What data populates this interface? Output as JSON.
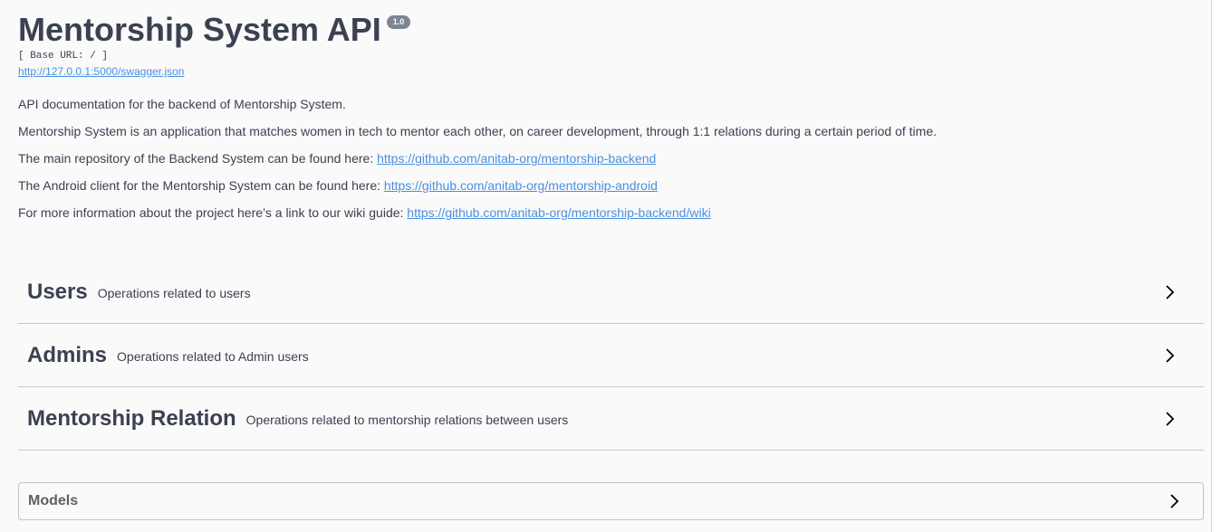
{
  "header": {
    "title": "Mentorship System API",
    "version": "1.0",
    "base_url": "[ Base URL: / ]",
    "spec_link": "http://127.0.0.1:5000/swagger.json"
  },
  "description": {
    "line1": "API documentation for the backend of Mentorship System.",
    "line2": "Mentorship System is an application that matches women in tech to mentor each other, on career development, through 1:1 relations during a certain period of time.",
    "line3_text": "The main repository of the Backend System can be found here: ",
    "line3_link": "https://github.com/anitab-org/mentorship-backend",
    "line4_text": "The Android client for the Mentorship System can be found here: ",
    "line4_link": "https://github.com/anitab-org/mentorship-android",
    "line5_text": "For more information about the project here’s a link to our wiki guide: ",
    "line5_link": "https://github.com/anitab-org/mentorship-backend/wiki"
  },
  "tags": [
    {
      "name": "Users",
      "description": "Operations related to users"
    },
    {
      "name": "Admins",
      "description": "Operations related to Admin users"
    },
    {
      "name": "Mentorship Relation",
      "description": "Operations related to mentorship relations between users"
    }
  ],
  "models": {
    "title": "Models"
  },
  "icons": {
    "expand": "chevron-right-icon"
  },
  "colors": {
    "text": "#3b4151",
    "link": "#4990e2",
    "badge": "#7d8492",
    "background": "#fafafa"
  }
}
